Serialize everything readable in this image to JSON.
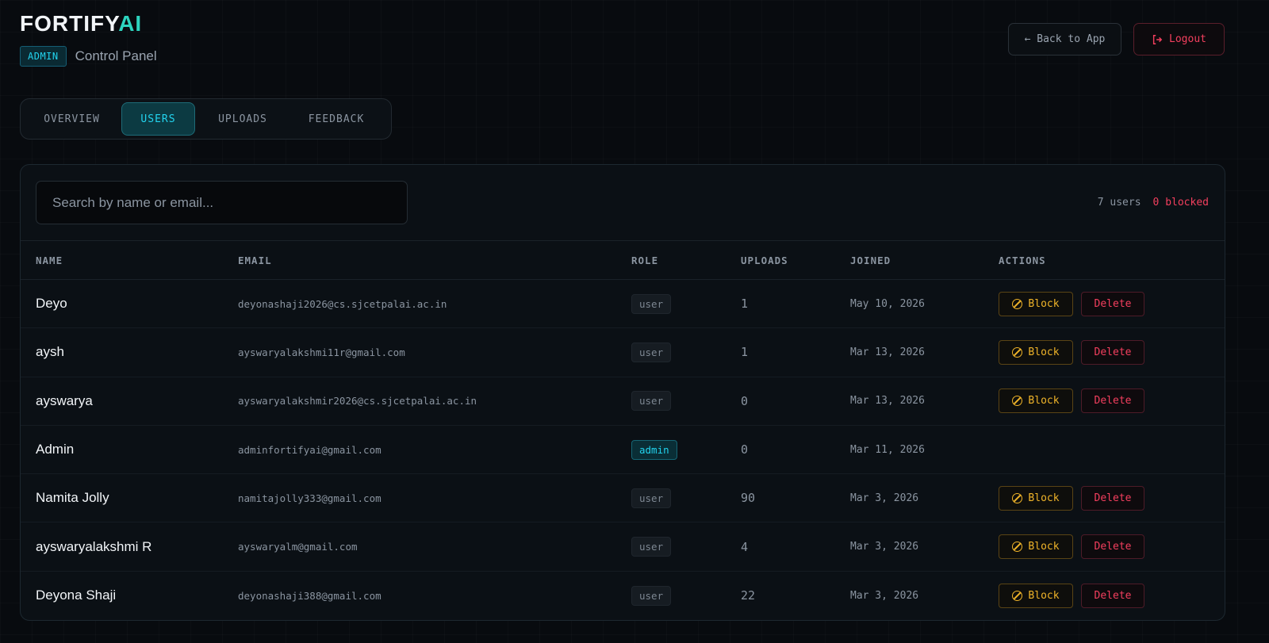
{
  "brand": {
    "name_main": "FORTIFY",
    "name_accent": "AI",
    "admin_tag": "ADMIN",
    "subtitle": "Control Panel"
  },
  "header": {
    "back_label": "← Back to App",
    "logout_label": "Logout"
  },
  "tabs": [
    {
      "label": "OVERVIEW",
      "active": false
    },
    {
      "label": "USERS",
      "active": true
    },
    {
      "label": "UPLOADS",
      "active": false
    },
    {
      "label": "FEEDBACK",
      "active": false
    }
  ],
  "search": {
    "placeholder": "Search by name or email...",
    "value": ""
  },
  "counts": {
    "users": "7 users",
    "blocked": "0 blocked"
  },
  "columns": {
    "name": "NAME",
    "email": "EMAIL",
    "role": "ROLE",
    "uploads": "UPLOADS",
    "joined": "JOINED",
    "actions": "ACTIONS"
  },
  "actions": {
    "block": "Block",
    "delete": "Delete"
  },
  "users": [
    {
      "name": "Deyo",
      "email": "deyonashaji2026@cs.sjcetpalai.ac.in",
      "role": "user",
      "uploads": "1",
      "joined": "May 10, 2026"
    },
    {
      "name": "aysh",
      "email": "ayswaryalakshmi11r@gmail.com",
      "role": "user",
      "uploads": "1",
      "joined": "Mar 13, 2026"
    },
    {
      "name": "ayswarya",
      "email": "ayswaryalakshmir2026@cs.sjcetpalai.ac.in",
      "role": "user",
      "uploads": "0",
      "joined": "Mar 13, 2026"
    },
    {
      "name": "Admin",
      "email": "adminfortifyai@gmail.com",
      "role": "admin",
      "uploads": "0",
      "joined": "Mar 11, 2026"
    },
    {
      "name": "Namita Jolly",
      "email": "namitajolly333@gmail.com",
      "role": "user",
      "uploads": "90",
      "joined": "Mar 3, 2026"
    },
    {
      "name": "ayswaryalakshmi R",
      "email": "ayswaryalm@gmail.com",
      "role": "user",
      "uploads": "4",
      "joined": "Mar 3, 2026"
    },
    {
      "name": "Deyona Shaji",
      "email": "deyonashaji388@gmail.com",
      "role": "user",
      "uploads": "22",
      "joined": "Mar 3, 2026"
    }
  ],
  "colors": {
    "accent": "#22d3ee",
    "brand_accent": "#2dd4bf",
    "warning": "#f0b429",
    "danger": "#f43f5e",
    "background": "#080b0f"
  }
}
